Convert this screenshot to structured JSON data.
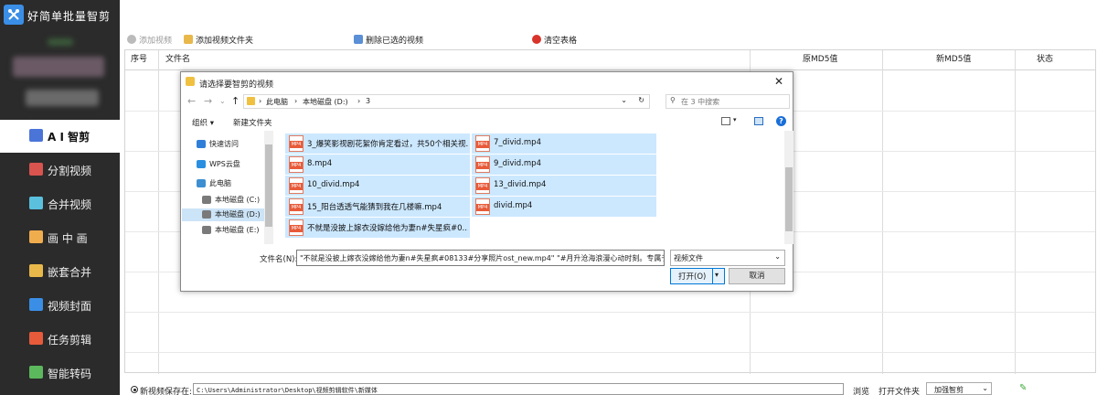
{
  "app": {
    "title": "好简单批量智剪"
  },
  "sidebar": {
    "items": [
      {
        "label": "A I 智剪",
        "icon": "ai-cut-icon",
        "active": true
      },
      {
        "label": "分割视频",
        "icon": "split-video-icon"
      },
      {
        "label": "合并视频",
        "icon": "merge-video-icon"
      },
      {
        "label": "画 中 画",
        "icon": "picture-in-picture-icon"
      },
      {
        "label": "嵌套合并",
        "icon": "nested-merge-icon"
      },
      {
        "label": "视频封面",
        "icon": "video-cover-icon"
      },
      {
        "label": "任务剪辑",
        "icon": "task-edit-icon"
      },
      {
        "label": "智能转码",
        "icon": "smart-transcode-icon"
      }
    ]
  },
  "toolbar": {
    "add_video": "添加视频",
    "add_folder": "添加视频文件夹",
    "delete_selected": "删除已选的视频",
    "clear_table": "清空表格"
  },
  "table": {
    "columns": [
      "序号",
      "文件名",
      "原MD5值",
      "新MD5值",
      "状态"
    ]
  },
  "bottom": {
    "save_label": "新视频保存在:",
    "save_path": "C:\\Users\\Administrator\\Desktop\\视频剪辑软件\\新媒体",
    "browse": "浏览",
    "open_folder": "打开文件夹",
    "select_value": "加强智剪"
  },
  "dialog": {
    "title": "请选择要智剪的视频",
    "breadcrumb": [
      "此电脑",
      "本地磁盘 (D:)",
      "3"
    ],
    "search_placeholder": "在 3 中搜索",
    "organize": "组织 ▾",
    "new_folder": "新建文件夹",
    "nav": [
      {
        "label": "快速访问",
        "icon": "star-icon",
        "color": "#2f7fd8"
      },
      {
        "label": "WPS云盘",
        "icon": "cloud-icon",
        "color": "#2a8fe0"
      },
      {
        "label": "此电脑",
        "icon": "computer-icon",
        "color": "#3d8fd1"
      },
      {
        "label": "本地磁盘 (C:)",
        "icon": "drive-icon",
        "color": "#7a7a7a"
      },
      {
        "label": "本地磁盘 (D:)",
        "icon": "drive-icon",
        "color": "#7a7a7a",
        "selected": true
      },
      {
        "label": "本地磁盘 (E:)",
        "icon": "drive-icon",
        "color": "#7a7a7a"
      }
    ],
    "files": [
      "3_爆笑影视剧花絮你肯定看过，共50个相关视...",
      "7_divid.mp4",
      "8.mp4",
      "9_divid.mp4",
      "10_divid.mp4",
      "13_divid.mp4",
      "15_阳台透透气能猜到我在几楼嘛.mp4",
      "divid.mp4",
      "不就是没披上嫁衣没嫁给他为妻n#失星疯#0..."
    ],
    "file_badge": "MP4",
    "filename_label": "文件名(N):",
    "filename_value": "\"不就是没披上嫁衣没嫁给他为妻n#失星疯#08133#分享照片ost_new.mp4\" \"#月升沧海浪漫心动时刻。专属于",
    "filetype": "视频文件",
    "open": "打开(O)",
    "cancel": "取消"
  }
}
